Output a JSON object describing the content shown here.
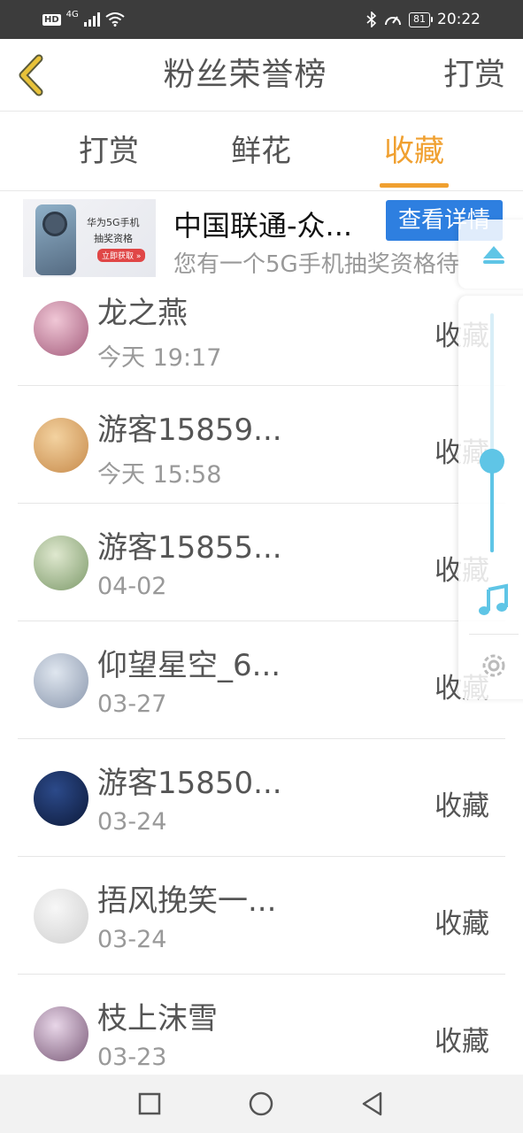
{
  "status_bar": {
    "hd": "HD",
    "network": "4G",
    "battery": "81",
    "time": "20:22"
  },
  "header": {
    "title": "粉丝荣誉榜",
    "action_label": "打赏"
  },
  "tabs": [
    {
      "label": "打赏",
      "active": false
    },
    {
      "label": "鲜花",
      "active": false
    },
    {
      "label": "收藏",
      "active": true
    }
  ],
  "ad": {
    "title": "中国联通-众...",
    "subtitle": "您有一个5G手机抽奖资格待",
    "button_label": "查看详情",
    "image_text_line1": "华为5G手机",
    "image_text_line2": "抽奖资格",
    "image_pill": "立即获取 »"
  },
  "list": [
    {
      "name": "龙之燕",
      "time": "今天 19:17",
      "action": "收藏",
      "avatar_colors": [
        "#f0c7d6",
        "#a45c7c"
      ]
    },
    {
      "name": "游客15859...",
      "time": "今天 15:58",
      "action": "收藏",
      "avatar_colors": [
        "#f3d2a0",
        "#c78a4a"
      ]
    },
    {
      "name": "游客15855...",
      "time": "04-02",
      "action": "收藏",
      "avatar_colors": [
        "#dfe8cf",
        "#7d9a6a"
      ]
    },
    {
      "name": "仰望星空_6...",
      "time": "03-27",
      "action": "收藏",
      "avatar_colors": [
        "#dfe6ef",
        "#8a97ad"
      ]
    },
    {
      "name": "游客15850...",
      "time": "03-24",
      "action": "收藏",
      "avatar_colors": [
        "#2c4a8a",
        "#0d1a3a"
      ]
    },
    {
      "name": "捂风挽笑一...",
      "time": "03-24",
      "action": "收藏",
      "avatar_colors": [
        "#f7f7f7",
        "#d0d0d0"
      ]
    },
    {
      "name": "枝上沫雪",
      "time": "03-23",
      "action": "收藏",
      "avatar_colors": [
        "#e8d6e8",
        "#7a5a78"
      ]
    }
  ],
  "floating_panel": {
    "slider_level": 0.38
  },
  "colors": {
    "accent": "#f0a030",
    "ad_button": "#2e7fe0",
    "slider": "#5fc5e6",
    "status_bar": "#3c3c3c"
  }
}
